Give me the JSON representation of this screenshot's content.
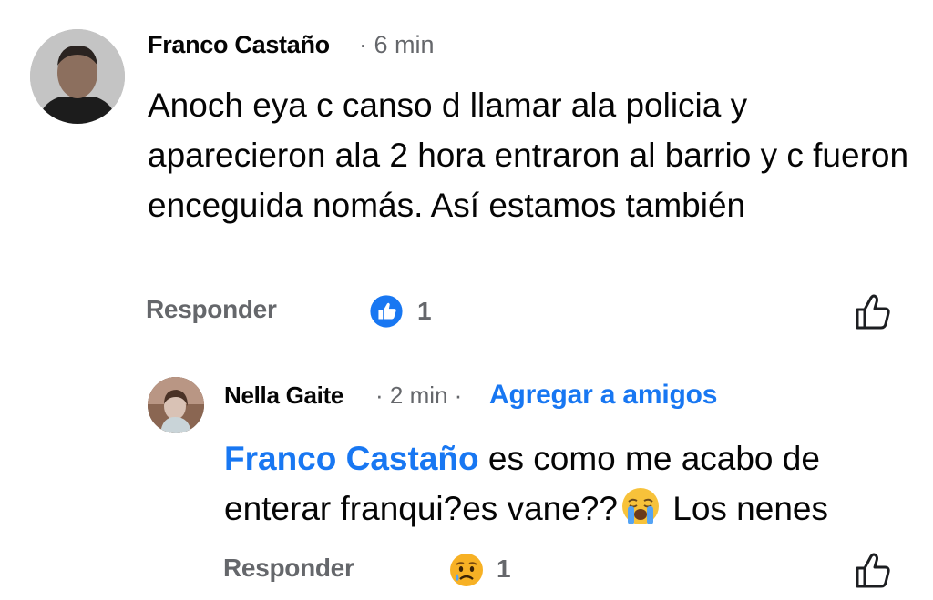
{
  "comments": [
    {
      "author": "Franco Castaño",
      "time_prefix": "· 6 min",
      "text": "Anoch eya c canso d llamar ala policia  y aparecieron ala 2 hora entraron al barrio y c fueron enceguida nomás.   Así estamos también",
      "reply_label": "Responder",
      "reaction": {
        "icon": "like-reaction-icon",
        "count": "1"
      },
      "like_button_icon": "thumbs-up-outline-icon"
    },
    {
      "author": "Nella Gaite",
      "time_prefix": "· 2 min ·",
      "add_friend_label": "Agregar a amigos",
      "mention": "Franco Castaño",
      "text_before_emoji": " es como me acabo de enterar franqui?es vane??",
      "inline_emoji": "loudly-crying-face-emoji",
      "text_after_emoji": " Los nenes",
      "reply_label": "Responder",
      "reaction": {
        "icon": "sad-reaction-icon",
        "count": "1"
      },
      "like_button_icon": "thumbs-up-outline-icon"
    }
  ],
  "colors": {
    "name": "#050505",
    "meta": "#65676b",
    "link": "#1877f2",
    "like_blue": "#1877f2",
    "sad_yellow": "#f7b125"
  }
}
